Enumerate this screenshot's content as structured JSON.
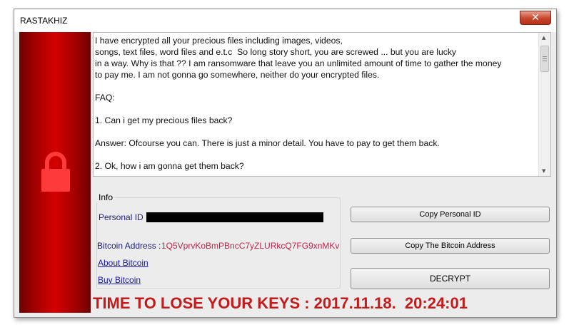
{
  "window": {
    "title": "RASTAKHIZ",
    "close_glyph": "✕"
  },
  "message": {
    "lines": [
      "I have encrypted all your precious files including images, videos,",
      "songs, text files, word files and e.t.c  So long story short, you are screwed ... but you are lucky",
      "in a way. Why is that ?? I am ransomware that leave you an unlimited amount of time to gather the money",
      "to pay me. I am not gonna go somewhere, neither do your encrypted files."
    ],
    "faq_heading": "FAQ:",
    "q1": "1. Can i get my precious files back?",
    "a1": "Answer: Ofcourse you can. There is just a minor detail. You have to pay to get them back.",
    "q2": "2. Ok, how i am gonna get them back?"
  },
  "info": {
    "legend": "Info",
    "personal_id_label": "Personal ID :",
    "bitcoin_address_label": "Bitcoin Address :",
    "bitcoin_address": "1Q5VprvKoBmPBncC7yZLURkcQ7FG9xnMKv",
    "about_bitcoin": "About Bitcoin",
    "buy_bitcoin": "Buy Bitcoin"
  },
  "buttons": {
    "copy_personal_id": "Copy Personal ID",
    "copy_bitcoin_address": "Copy The Bitcoin Address",
    "decrypt": "DECRYPT"
  },
  "deadline": "TIME TO LOSE YOUR KEYS : 2017.11.18.  20:24:01",
  "icons": {
    "lock": "lock-icon",
    "close": "close-icon"
  },
  "colors": {
    "accent_red": "#d40000",
    "deadline_red": "#c31a1a",
    "bitcoin_address": "#c0254a",
    "label_blue": "#1d1d7d"
  }
}
